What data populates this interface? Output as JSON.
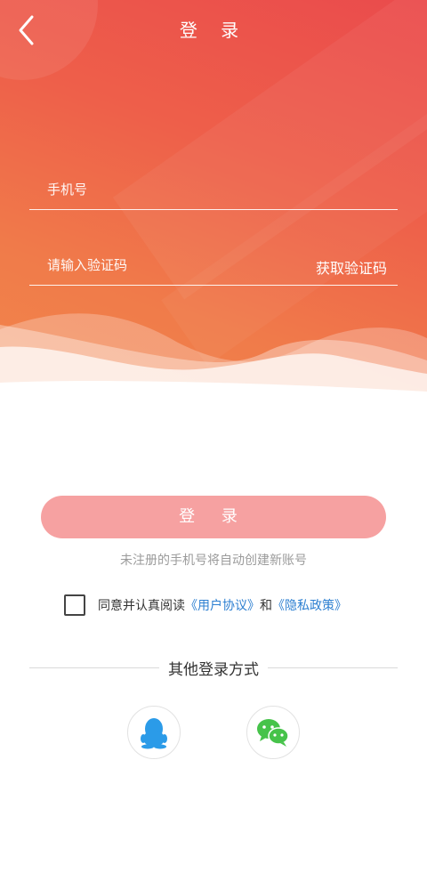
{
  "header": {
    "title": "登 录"
  },
  "form": {
    "phone_placeholder": "手机号",
    "code_placeholder": "请输入验证码",
    "get_code_label": "获取验证码"
  },
  "login_button": {
    "label": "登 录"
  },
  "note": "未注册的手机号将自动创建新账号",
  "agreement": {
    "prefix": "同意并认真阅读",
    "user_agreement": "《用户协议》",
    "and": "和",
    "privacy_policy": "《隐私政策》"
  },
  "other_login": {
    "title": "其他登录方式"
  },
  "colors": {
    "accent": "#ee5a4a",
    "button": "#f6a1a1",
    "link": "#2c7fd1",
    "qq": "#2b9be8",
    "wechat": "#46c34a"
  }
}
